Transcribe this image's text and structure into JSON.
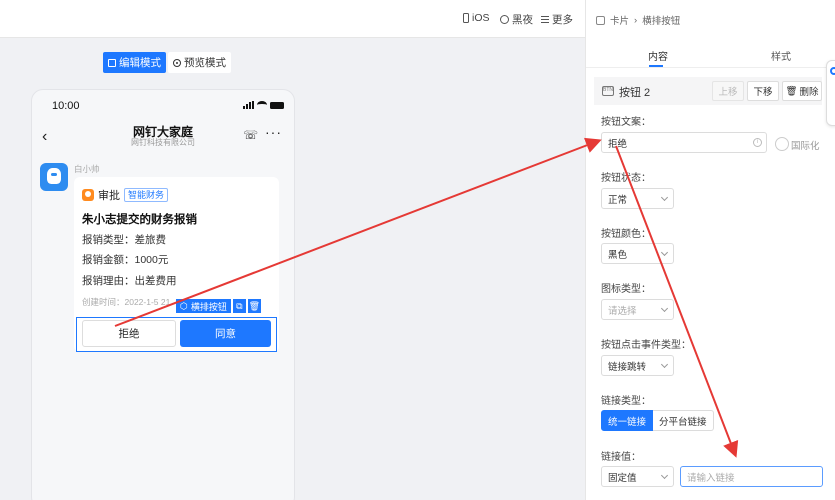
{
  "topbar": {
    "ios_label": "iOS",
    "dark_label": "黑夜",
    "more_label": "更多"
  },
  "modes": {
    "edit_label": "编辑模式",
    "preview_label": "预览模式"
  },
  "phone": {
    "time": "10:00",
    "chat_title": "网钉大家庭",
    "chat_subtitle": "网钉科技有限公司",
    "sender": "白小帅",
    "card": {
      "type": "审批",
      "tag": "智能财务",
      "title": "朱小志提交的财务报销",
      "lines": [
        "报销类型：差旅费",
        "报销金额：1000元",
        "报销理由：出差费用"
      ],
      "created": "创建时间：2022-1-5 21"
    },
    "selection_toolbar_label": "横排按钮",
    "buttons": {
      "reject": "拒绝",
      "agree": "同意"
    }
  },
  "panel": {
    "breadcrumb": [
      "卡片",
      "横排按钮"
    ],
    "tabs": [
      "内容",
      "样式"
    ],
    "component": {
      "icon_text": "BTN",
      "title": "按钮 2",
      "up": "上移",
      "down": "下移",
      "delete": "删除"
    },
    "fields": {
      "button_text_label": "按钮文案：",
      "button_text_value": "拒绝",
      "i18n_label": "国际化",
      "state_label": "按钮状态：",
      "state_value": "正常",
      "color_label": "按钮颜色：",
      "color_value": "黑色",
      "icon_type_label": "图标类型：",
      "icon_type_placeholder": "请选择",
      "event_label": "按钮点击事件类型：",
      "event_value": "链接跳转",
      "link_type_label": "链接类型：",
      "link_type_options": [
        "统一链接",
        "分平台链接"
      ],
      "link_value_label": "链接值：",
      "link_value_mode": "固定值",
      "link_value_placeholder": "请输入链接"
    }
  },
  "colors": {
    "accent": "#1e78ff",
    "annotation": "#e53935",
    "approval_icon": "#ff8b1f"
  }
}
